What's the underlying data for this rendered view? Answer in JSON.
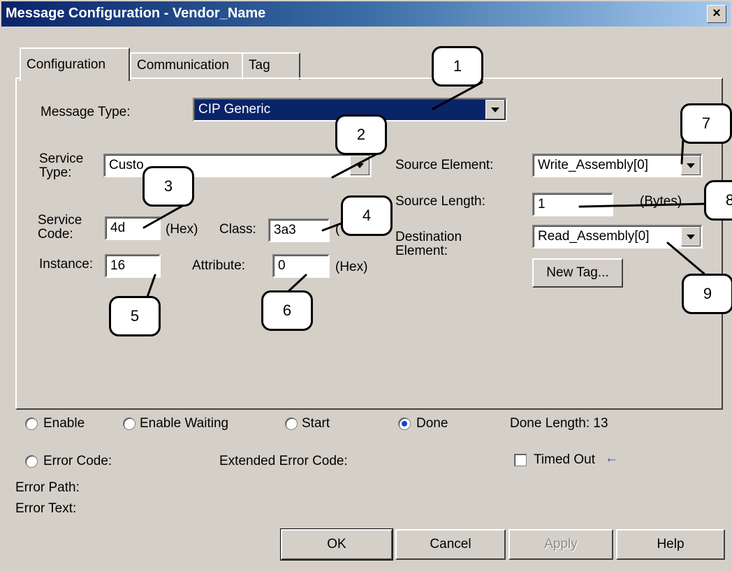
{
  "window": {
    "title": "Message Configuration - Vendor_Name",
    "close": "×"
  },
  "tabs": [
    {
      "label": "Configuration"
    },
    {
      "label": "Communication"
    },
    {
      "label": "Tag"
    }
  ],
  "config": {
    "message_type_label": "Message Type:",
    "message_type_value": "CIP Generic",
    "service_type_label": "Service\nType:",
    "service_type_value": "Custo",
    "service_code_label": "Service\nCode:",
    "service_code_value": "4d",
    "hex_label": "(Hex)",
    "class_label": "Class:",
    "class_value": "3a3",
    "class_hex_fragment": "(",
    "instance_label": "Instance:",
    "instance_value": "16",
    "attribute_label": "Attribute:",
    "attribute_value": "0",
    "source_element_label": "Source Element:",
    "source_element_value": "Write_Assembly[0]",
    "source_length_label": "Source Length:",
    "source_length_value": "1",
    "bytes_label": "(Bytes)",
    "destination_element_label": "Destination\nElement:",
    "destination_element_value": "Read_Assembly[0]",
    "new_tag_label": "New Tag..."
  },
  "status": {
    "enable": "Enable",
    "enable_waiting": "Enable Waiting",
    "start": "Start",
    "done": "Done",
    "done_length": "Done Length: 13",
    "error_code": "Error Code:",
    "extended_error_code": "Extended Error Code:",
    "timed_out": "Timed Out",
    "timed_out_arrow": "←",
    "error_path": "Error Path:",
    "error_text": "Error Text:"
  },
  "buttons": {
    "ok": "OK",
    "cancel": "Cancel",
    "apply": "Apply",
    "help": "Help"
  },
  "callouts": [
    "1",
    "2",
    "3",
    "4",
    "5",
    "6",
    "7",
    "8",
    "9"
  ]
}
